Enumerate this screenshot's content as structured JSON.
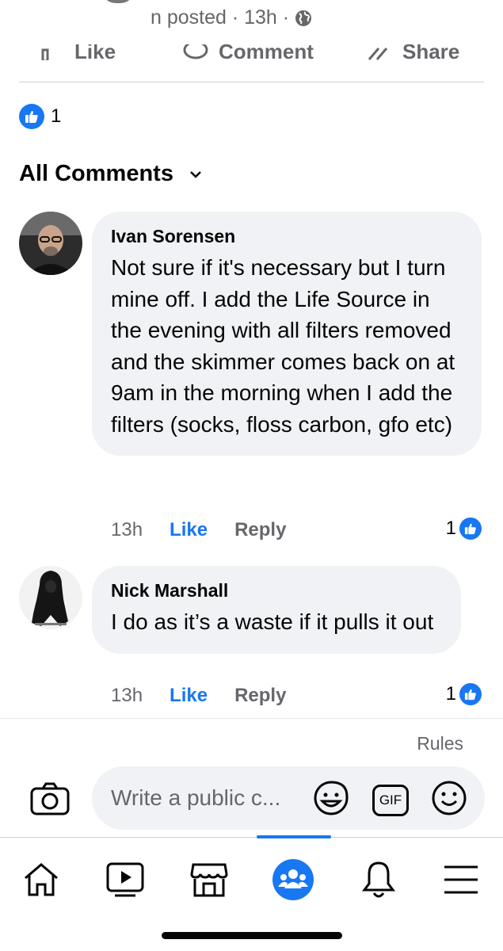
{
  "post": {
    "posted_text": "n posted · 13h ·",
    "actions": [
      "Like",
      "Comment",
      "Share"
    ]
  },
  "reactions": {
    "count": "1"
  },
  "comments_header": {
    "label": "All Comments"
  },
  "comments": [
    {
      "name": "Ivan Sorensen",
      "text": "Not sure if it's necessary but I turn mine off. I add the Life Source in the evening with all filters removed and the skimmer comes back on at 9am in the morning when I add the filters (socks, floss carbon, gfo etc)",
      "time": "13h",
      "like_label": "Like",
      "reply_label": "Reply",
      "reaction_count": "1"
    },
    {
      "name": "Nick Marshall",
      "text": "I do as it’s a waste if it pulls it out",
      "time": "13h",
      "like_label": "Like",
      "reply_label": "Reply",
      "reaction_count": "1"
    }
  ],
  "composer": {
    "rules_label": "Rules",
    "placeholder": "Write a public c...",
    "gif_label": "GIF"
  },
  "tabbar": {
    "items": [
      "home-icon",
      "video-icon",
      "marketplace-icon",
      "groups-icon",
      "notifications-icon",
      "menu-icon"
    ],
    "active": "groups-icon"
  },
  "colors": {
    "accent": "#1877f2",
    "secondary_text": "#65676b",
    "bubble": "#f0f2f5"
  }
}
